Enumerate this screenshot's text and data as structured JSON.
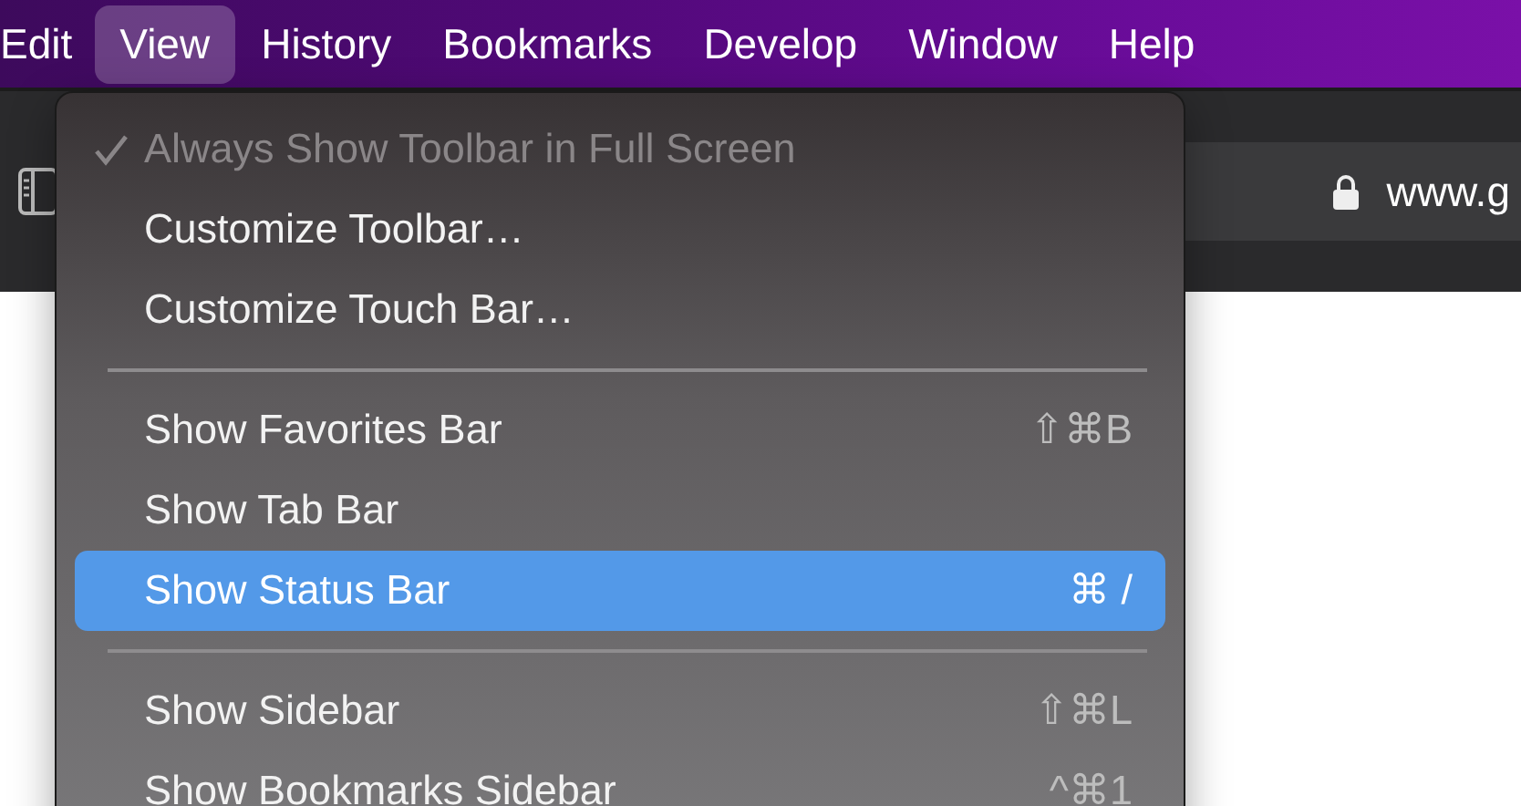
{
  "menu_bar": [
    {
      "label": "Edit",
      "selected": false
    },
    {
      "label": "View",
      "selected": true
    },
    {
      "label": "History",
      "selected": false
    },
    {
      "label": "Bookmarks",
      "selected": false
    },
    {
      "label": "Develop",
      "selected": false
    },
    {
      "label": "Window",
      "selected": false
    },
    {
      "label": "Help",
      "selected": false
    }
  ],
  "address_bar": {
    "value": "www.g"
  },
  "view_menu": [
    {
      "kind": "item",
      "label": "Always Show Toolbar in Full Screen",
      "checked": true,
      "disabled": true,
      "selected": false
    },
    {
      "kind": "item",
      "label": "Customize Toolbar…",
      "checked": false,
      "disabled": false,
      "selected": false
    },
    {
      "kind": "item",
      "label": "Customize Touch Bar…",
      "checked": false,
      "disabled": false,
      "selected": false
    },
    {
      "kind": "separator"
    },
    {
      "kind": "item",
      "label": "Show Favorites Bar",
      "shortcut": "⇧⌘B",
      "checked": false,
      "disabled": false,
      "selected": false
    },
    {
      "kind": "item",
      "label": "Show Tab Bar",
      "checked": false,
      "disabled": false,
      "selected": false
    },
    {
      "kind": "item",
      "label": "Show Status Bar",
      "shortcut": "⌘ /",
      "checked": false,
      "disabled": false,
      "selected": true
    },
    {
      "kind": "separator"
    },
    {
      "kind": "item",
      "label": "Show Sidebar",
      "shortcut": "⇧⌘L",
      "checked": false,
      "disabled": false,
      "selected": false
    },
    {
      "kind": "item",
      "label": "Show Bookmarks Sidebar",
      "shortcut": "^⌘1",
      "checked": false,
      "disabled": false,
      "selected": false
    }
  ]
}
